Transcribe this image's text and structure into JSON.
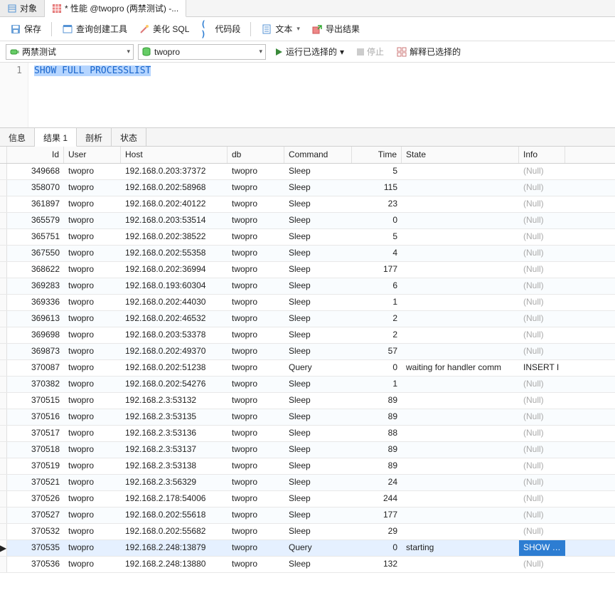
{
  "topTabs": {
    "objects": "对象",
    "queryTab": "* 性能 @twopro (两禁测试) -..."
  },
  "toolbar": {
    "save": "保存",
    "queryBuilder": "查询创建工具",
    "beautifySql": "美化 SQL",
    "codeSnippet": "代码段",
    "text": "文本",
    "exportResult": "导出结果"
  },
  "runbar": {
    "connection": "两禁测试",
    "database": "twopro",
    "runSelected": "运行已选择的",
    "stop": "停止",
    "explainSelected": "解释已选择的"
  },
  "editor": {
    "lineNo": "1",
    "sql": "SHOW FULL PROCESSLIST"
  },
  "midTabs": {
    "info": "信息",
    "result1": "结果 1",
    "profile": "剖析",
    "status": "状态"
  },
  "columns": {
    "id": "Id",
    "user": "User",
    "host": "Host",
    "db": "db",
    "command": "Command",
    "time": "Time",
    "state": "State",
    "info": "Info"
  },
  "nullText": "(Null)",
  "rows": [
    {
      "id": "349668",
      "user": "twopro",
      "host": "192.168.0.203:37372",
      "db": "twopro",
      "cmd": "Sleep",
      "time": "5",
      "state": "",
      "info": null
    },
    {
      "id": "358070",
      "user": "twopro",
      "host": "192.168.0.202:58968",
      "db": "twopro",
      "cmd": "Sleep",
      "time": "115",
      "state": "",
      "info": null
    },
    {
      "id": "361897",
      "user": "twopro",
      "host": "192.168.0.202:40122",
      "db": "twopro",
      "cmd": "Sleep",
      "time": "23",
      "state": "",
      "info": null
    },
    {
      "id": "365579",
      "user": "twopro",
      "host": "192.168.0.203:53514",
      "db": "twopro",
      "cmd": "Sleep",
      "time": "0",
      "state": "",
      "info": null
    },
    {
      "id": "365751",
      "user": "twopro",
      "host": "192.168.0.202:38522",
      "db": "twopro",
      "cmd": "Sleep",
      "time": "5",
      "state": "",
      "info": null
    },
    {
      "id": "367550",
      "user": "twopro",
      "host": "192.168.0.202:55358",
      "db": "twopro",
      "cmd": "Sleep",
      "time": "4",
      "state": "",
      "info": null
    },
    {
      "id": "368622",
      "user": "twopro",
      "host": "192.168.0.202:36994",
      "db": "twopro",
      "cmd": "Sleep",
      "time": "177",
      "state": "",
      "info": null
    },
    {
      "id": "369283",
      "user": "twopro",
      "host": "192.168.0.193:60304",
      "db": "twopro",
      "cmd": "Sleep",
      "time": "6",
      "state": "",
      "info": null
    },
    {
      "id": "369336",
      "user": "twopro",
      "host": "192.168.0.202:44030",
      "db": "twopro",
      "cmd": "Sleep",
      "time": "1",
      "state": "",
      "info": null
    },
    {
      "id": "369613",
      "user": "twopro",
      "host": "192.168.0.202:46532",
      "db": "twopro",
      "cmd": "Sleep",
      "time": "2",
      "state": "",
      "info": null
    },
    {
      "id": "369698",
      "user": "twopro",
      "host": "192.168.0.203:53378",
      "db": "twopro",
      "cmd": "Sleep",
      "time": "2",
      "state": "",
      "info": null
    },
    {
      "id": "369873",
      "user": "twopro",
      "host": "192.168.0.202:49370",
      "db": "twopro",
      "cmd": "Sleep",
      "time": "57",
      "state": "",
      "info": null
    },
    {
      "id": "370087",
      "user": "twopro",
      "host": "192.168.0.202:51238",
      "db": "twopro",
      "cmd": "Query",
      "time": "0",
      "state": "waiting for handler comm",
      "info": "INSERT I"
    },
    {
      "id": "370382",
      "user": "twopro",
      "host": "192.168.0.202:54276",
      "db": "twopro",
      "cmd": "Sleep",
      "time": "1",
      "state": "",
      "info": null
    },
    {
      "id": "370515",
      "user": "twopro",
      "host": "192.168.2.3:53132",
      "db": "twopro",
      "cmd": "Sleep",
      "time": "89",
      "state": "",
      "info": null
    },
    {
      "id": "370516",
      "user": "twopro",
      "host": "192.168.2.3:53135",
      "db": "twopro",
      "cmd": "Sleep",
      "time": "89",
      "state": "",
      "info": null
    },
    {
      "id": "370517",
      "user": "twopro",
      "host": "192.168.2.3:53136",
      "db": "twopro",
      "cmd": "Sleep",
      "time": "88",
      "state": "",
      "info": null
    },
    {
      "id": "370518",
      "user": "twopro",
      "host": "192.168.2.3:53137",
      "db": "twopro",
      "cmd": "Sleep",
      "time": "89",
      "state": "",
      "info": null
    },
    {
      "id": "370519",
      "user": "twopro",
      "host": "192.168.2.3:53138",
      "db": "twopro",
      "cmd": "Sleep",
      "time": "89",
      "state": "",
      "info": null
    },
    {
      "id": "370521",
      "user": "twopro",
      "host": "192.168.2.3:56329",
      "db": "twopro",
      "cmd": "Sleep",
      "time": "24",
      "state": "",
      "info": null
    },
    {
      "id": "370526",
      "user": "twopro",
      "host": "192.168.2.178:54006",
      "db": "twopro",
      "cmd": "Sleep",
      "time": "244",
      "state": "",
      "info": null
    },
    {
      "id": "370527",
      "user": "twopro",
      "host": "192.168.0.202:55618",
      "db": "twopro",
      "cmd": "Sleep",
      "time": "177",
      "state": "",
      "info": null
    },
    {
      "id": "370532",
      "user": "twopro",
      "host": "192.168.0.202:55682",
      "db": "twopro",
      "cmd": "Sleep",
      "time": "29",
      "state": "",
      "info": null
    },
    {
      "id": "370535",
      "user": "twopro",
      "host": "192.168.2.248:13879",
      "db": "twopro",
      "cmd": "Query",
      "time": "0",
      "state": "starting",
      "info": "SHOW FU",
      "selected": true,
      "hlinfo": true
    },
    {
      "id": "370536",
      "user": "twopro",
      "host": "192.168.2.248:13880",
      "db": "twopro",
      "cmd": "Sleep",
      "time": "132",
      "state": "",
      "info": null
    }
  ]
}
